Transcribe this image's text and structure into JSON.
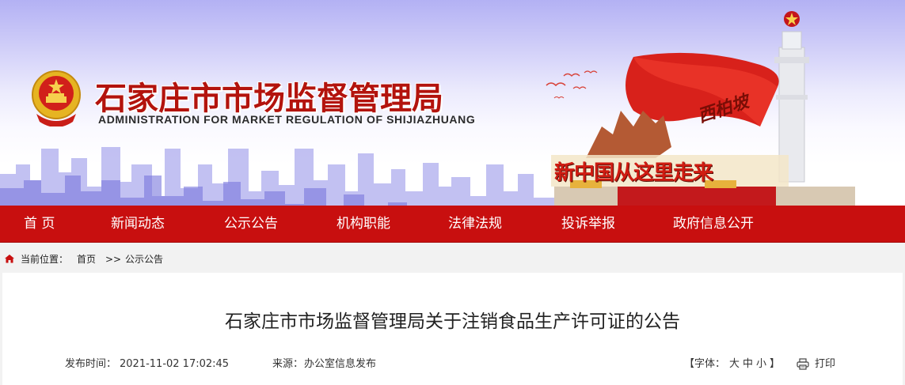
{
  "header": {
    "title_cn": "石家庄市市场监督管理局",
    "title_en": "ADMINISTRATION FOR MARKET REGULATION OF SHIJIAZHUANG",
    "slogan": "新中国从这里走来",
    "flag_text": "西柏坡",
    "brand_red": "#c80f0f"
  },
  "nav": {
    "items": [
      {
        "label": "首 页"
      },
      {
        "label": "新闻动态"
      },
      {
        "label": "公示公告"
      },
      {
        "label": "机构职能"
      },
      {
        "label": "法律法规"
      },
      {
        "label": "投诉举报"
      },
      {
        "label": "政府信息公开"
      }
    ]
  },
  "breadcrumb": {
    "icon": "home-icon",
    "prefix": "当前位置：",
    "home": "首页",
    "separator": ">>",
    "current": "公示公告"
  },
  "article": {
    "title": "石家庄市市场监督管理局关于注销食品生产许可证的公告",
    "publish_label": "发布时间：",
    "publish_time": "2021-11-02  17:02:45",
    "source_label": "来源：",
    "source": "办公室信息发布",
    "font_open": "【字体：",
    "font_large": "大",
    "font_medium": "中",
    "font_small": "小",
    "font_close": "】",
    "print_icon": "printer-icon",
    "print_label": "打印"
  }
}
